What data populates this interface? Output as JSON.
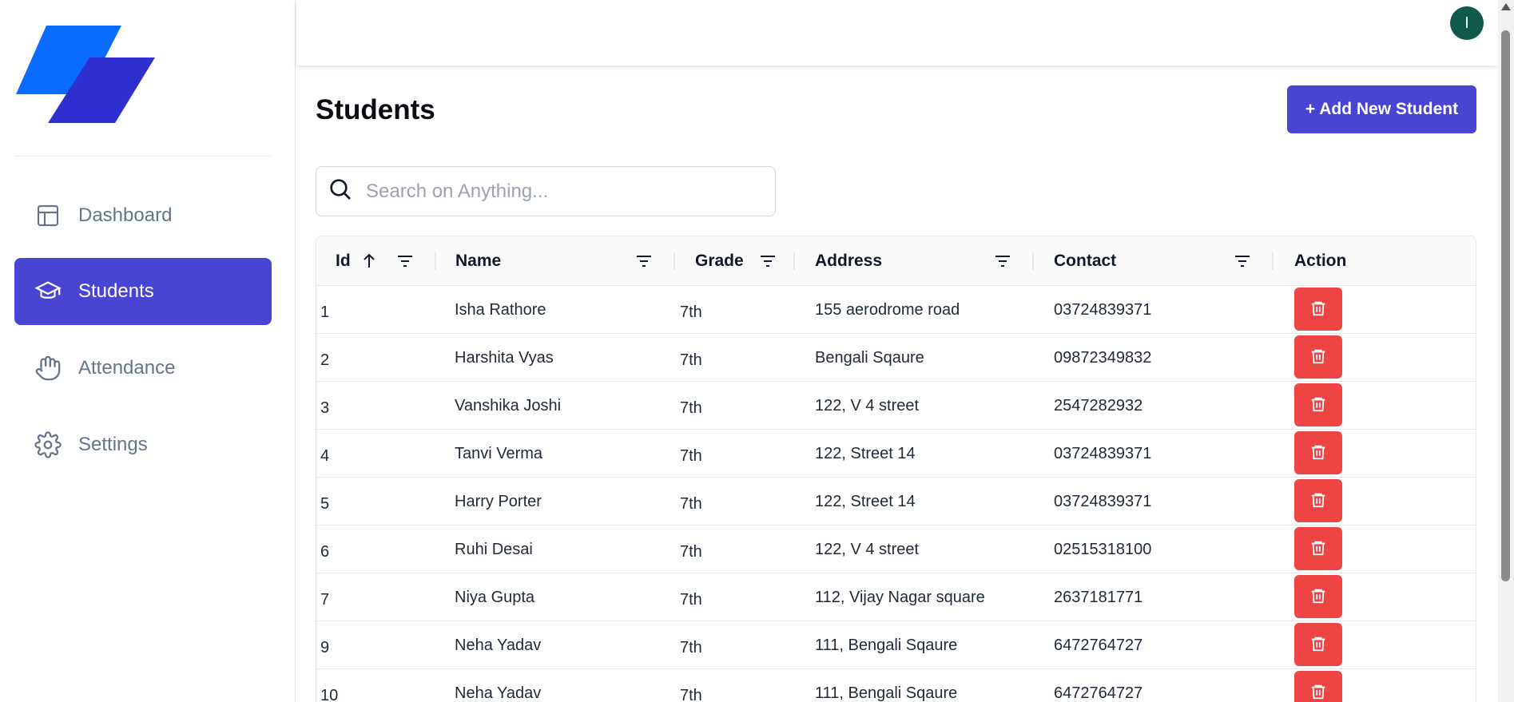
{
  "sidebar": {
    "items": [
      {
        "label": "Dashboard",
        "icon": "layout-icon",
        "active": false
      },
      {
        "label": "Students",
        "icon": "graduation-cap-icon",
        "active": true
      },
      {
        "label": "Attendance",
        "icon": "hand-icon",
        "active": false
      },
      {
        "label": "Settings",
        "icon": "gear-icon",
        "active": false
      }
    ]
  },
  "header": {
    "avatar_initial": "I"
  },
  "main": {
    "title": "Students",
    "add_button_label": "+ Add New Student",
    "search_placeholder": "Search on Anything...",
    "table": {
      "columns": [
        "Id",
        "Name",
        "Grade",
        "Address",
        "Contact",
        "Action"
      ],
      "rows": [
        {
          "id": "1",
          "name": "Isha Rathore",
          "grade": "7th",
          "address": "155 aerodrome road",
          "contact": "03724839371"
        },
        {
          "id": "2",
          "name": "Harshita Vyas",
          "grade": "7th",
          "address": "Bengali Sqaure",
          "contact": "09872349832"
        },
        {
          "id": "3",
          "name": "Vanshika Joshi",
          "grade": "7th",
          "address": "122, V 4 street",
          "contact": "2547282932"
        },
        {
          "id": "4",
          "name": "Tanvi Verma",
          "grade": "7th",
          "address": "122, Street 14",
          "contact": "03724839371"
        },
        {
          "id": "5",
          "name": "Harry Porter",
          "grade": "7th",
          "address": "122, Street 14",
          "contact": "03724839371"
        },
        {
          "id": "6",
          "name": "Ruhi Desai",
          "grade": "7th",
          "address": "122, V 4 street",
          "contact": "02515318100"
        },
        {
          "id": "7",
          "name": "Niya Gupta",
          "grade": "7th",
          "address": "112, Vijay Nagar square",
          "contact": "2637181771"
        },
        {
          "id": "9",
          "name": "Neha Yadav",
          "grade": "7th",
          "address": "111, Bengali Sqaure",
          "contact": "6472764727"
        },
        {
          "id": "10",
          "name": "Neha Yadav",
          "grade": "7th",
          "address": "111, Bengali Sqaure",
          "contact": "6472764727"
        }
      ]
    }
  },
  "colors": {
    "accent": "#4845d2",
    "danger": "#ef4444",
    "avatar": "#0f5a4a"
  }
}
